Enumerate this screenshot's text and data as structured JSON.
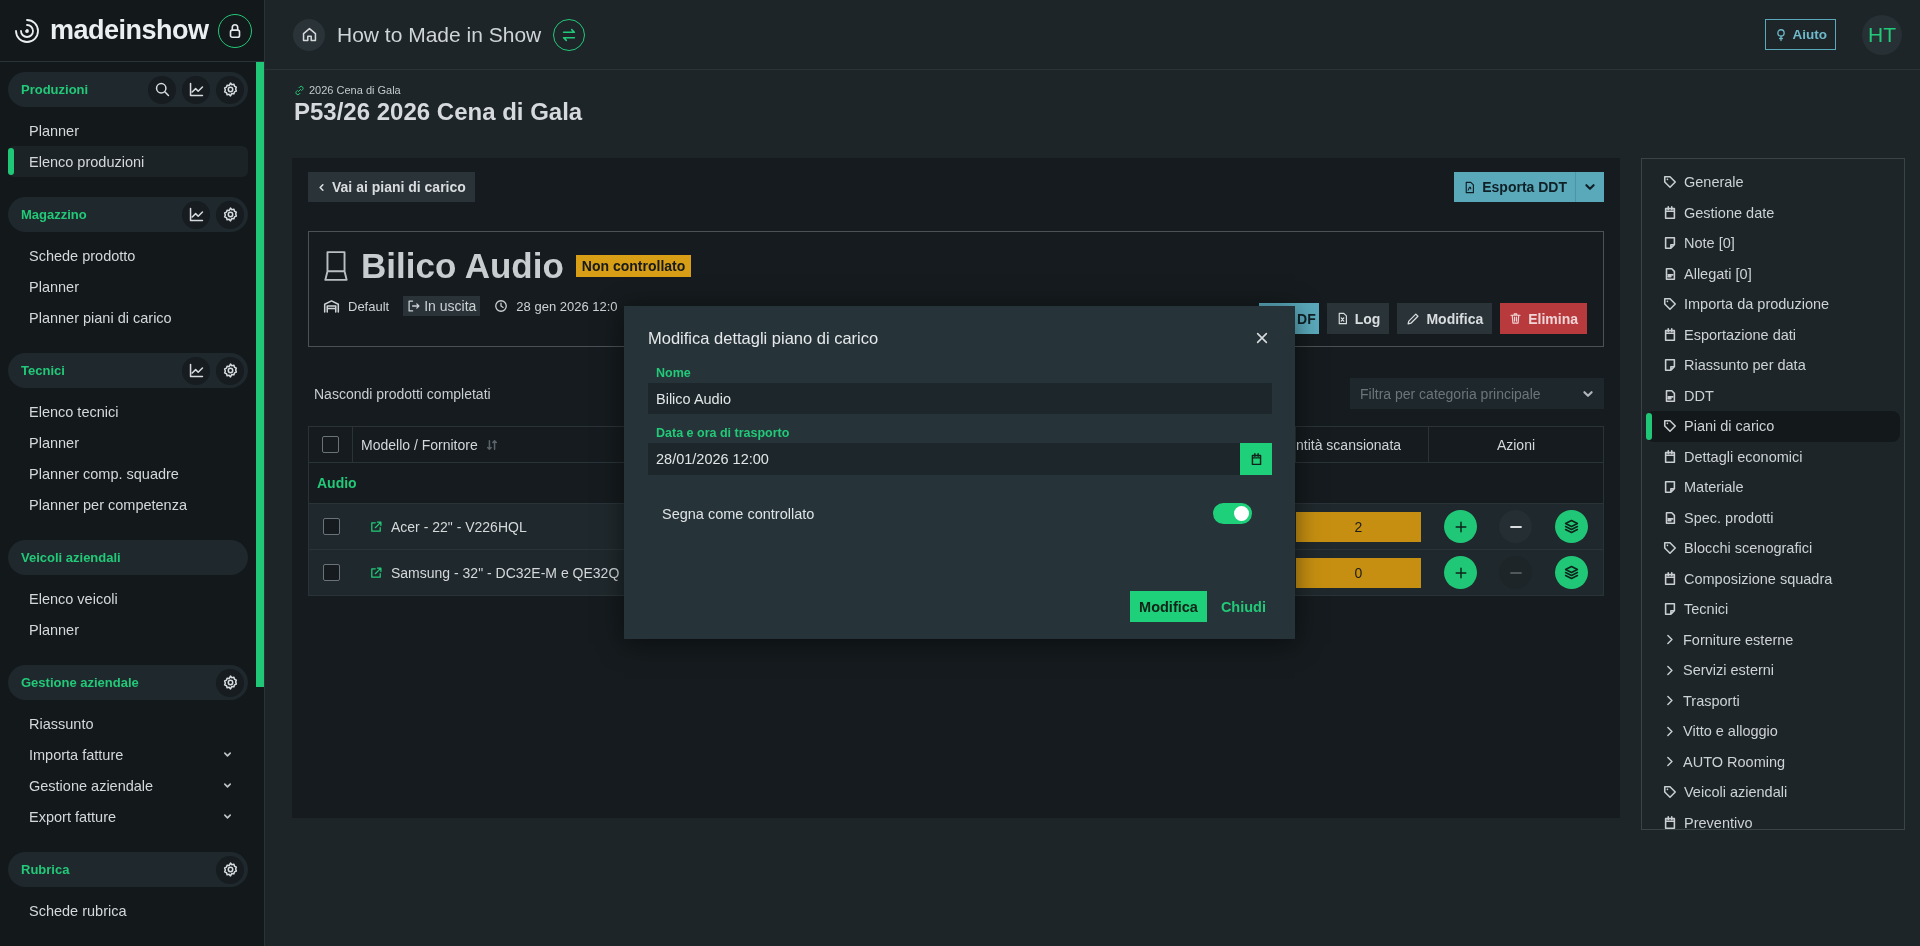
{
  "sidebar": {
    "logo": "madeinshow",
    "sections": [
      {
        "title": "Produzioni",
        "search": true,
        "stats": true,
        "settings": true,
        "items": [
          {
            "label": "Planner",
            "selected": false,
            "kind": "link"
          },
          {
            "label": "Elenco produzioni",
            "selected": true,
            "kind": "link"
          }
        ]
      },
      {
        "title": "Magazzino",
        "stats": true,
        "settings": true,
        "items": [
          {
            "label": "Schede prodotto",
            "selected": false,
            "kind": "link"
          },
          {
            "label": "Planner",
            "selected": false,
            "kind": "link"
          },
          {
            "label": "Planner piani di carico",
            "selected": false,
            "kind": "link"
          }
        ]
      },
      {
        "title": "Tecnici",
        "stats": true,
        "settings": true,
        "items": [
          {
            "label": "Elenco tecnici",
            "selected": false,
            "kind": "link"
          },
          {
            "label": "Planner",
            "selected": false,
            "kind": "link"
          },
          {
            "label": "Planner comp. squadre",
            "selected": false,
            "kind": "link"
          },
          {
            "label": "Planner per competenza",
            "selected": false,
            "kind": "link"
          }
        ]
      },
      {
        "title": "Veicoli aziendali",
        "items": [
          {
            "label": "Elenco veicoli",
            "selected": false,
            "kind": "link"
          },
          {
            "label": "Planner",
            "selected": false,
            "kind": "link"
          }
        ]
      },
      {
        "title": "Gestione aziendale",
        "settings": true,
        "items": [
          {
            "label": "Riassunto",
            "selected": false,
            "kind": "link"
          },
          {
            "label": "Importa fatture",
            "selected": false,
            "kind": "group"
          },
          {
            "label": "Gestione aziendale",
            "selected": false,
            "kind": "group"
          },
          {
            "label": "Export fatture",
            "selected": false,
            "kind": "group"
          }
        ]
      },
      {
        "title": "Rubrica",
        "settings": true,
        "items": [
          {
            "label": "Schede rubrica",
            "selected": false,
            "kind": "link"
          }
        ]
      }
    ]
  },
  "header": {
    "title": "How to Made in Show",
    "help": "Aiuto",
    "avatar": "HT"
  },
  "page": {
    "breadcrumb": "2026 Cena di Gala",
    "title": "P53/26 2026 Cena di Gala"
  },
  "toolbar": {
    "back": "Vai ai piani di carico",
    "export": "Esporta DDT"
  },
  "load_plan": {
    "title": "Bilico Audio",
    "status": "Non controllato",
    "warehouse": "Default",
    "direction": "In uscita",
    "date": "28 gen 2026 12:0",
    "buttons": [
      {
        "label": "DF",
        "kind": "pdf"
      },
      {
        "label": "Log",
        "kind": "log"
      },
      {
        "label": "Modifica",
        "kind": "edit"
      },
      {
        "label": "Elimina",
        "kind": "delete"
      }
    ]
  },
  "filters": {
    "hide_completed": "Nascondi prodotti completati",
    "category_placeholder": "Filtra per categoria principale"
  },
  "table": {
    "all_checked": false,
    "columns": [
      "Modello / Fornitore",
      "ntità scansionata",
      "Azioni"
    ],
    "group": "Audio",
    "rows": [
      {
        "model": "Acer - 22\" - V226HQL",
        "scanned": "2",
        "checked": false,
        "remove_disabled": false
      },
      {
        "model": "Samsung - 32\" - DC32E-M e QE32Q",
        "scanned": "0",
        "checked": false,
        "remove_disabled": true
      }
    ]
  },
  "modal": {
    "title": "Modifica dettagli piano di carico",
    "name_label": "Nome",
    "name_value": "Bilico Audio",
    "date_label": "Data e ora di trasporto",
    "date_value": "28/01/2026 12:00",
    "toggle_label": "Segna come controllato",
    "toggle_on": true,
    "submit": "Modifica",
    "close": "Chiudi"
  },
  "side_menu": [
    {
      "label": "Generale",
      "kind": "page",
      "selected": false
    },
    {
      "label": "Gestione date",
      "kind": "page",
      "selected": false
    },
    {
      "label": "Note [0]",
      "kind": "page",
      "selected": false
    },
    {
      "label": "Allegati [0]",
      "kind": "page",
      "selected": false
    },
    {
      "label": "Importa da produzione",
      "kind": "page",
      "selected": false
    },
    {
      "label": "Esportazione dati",
      "kind": "page",
      "selected": false
    },
    {
      "label": "Riassunto per data",
      "kind": "page",
      "selected": false
    },
    {
      "label": "DDT",
      "kind": "page",
      "selected": false
    },
    {
      "label": "Piani di carico",
      "kind": "page",
      "selected": true
    },
    {
      "label": "Dettagli economici",
      "kind": "page",
      "selected": false
    },
    {
      "label": "Materiale",
      "kind": "page",
      "selected": false
    },
    {
      "label": "Spec. prodotti",
      "kind": "page",
      "selected": false
    },
    {
      "label": "Blocchi scenografici",
      "kind": "page",
      "selected": false
    },
    {
      "label": "Composizione squadra",
      "kind": "page",
      "selected": false
    },
    {
      "label": "Tecnici",
      "kind": "page",
      "selected": false
    },
    {
      "label": "Forniture esterne",
      "kind": "group",
      "selected": false
    },
    {
      "label": "Servizi esterni",
      "kind": "group",
      "selected": false
    },
    {
      "label": "Trasporti",
      "kind": "group",
      "selected": false
    },
    {
      "label": "Vitto e alloggio",
      "kind": "group",
      "selected": false
    },
    {
      "label": "AUTO Rooming",
      "kind": "group",
      "selected": false
    },
    {
      "label": "Veicoli aziendali",
      "kind": "page",
      "selected": false
    },
    {
      "label": "Preventivo",
      "kind": "page",
      "selected": false
    }
  ]
}
